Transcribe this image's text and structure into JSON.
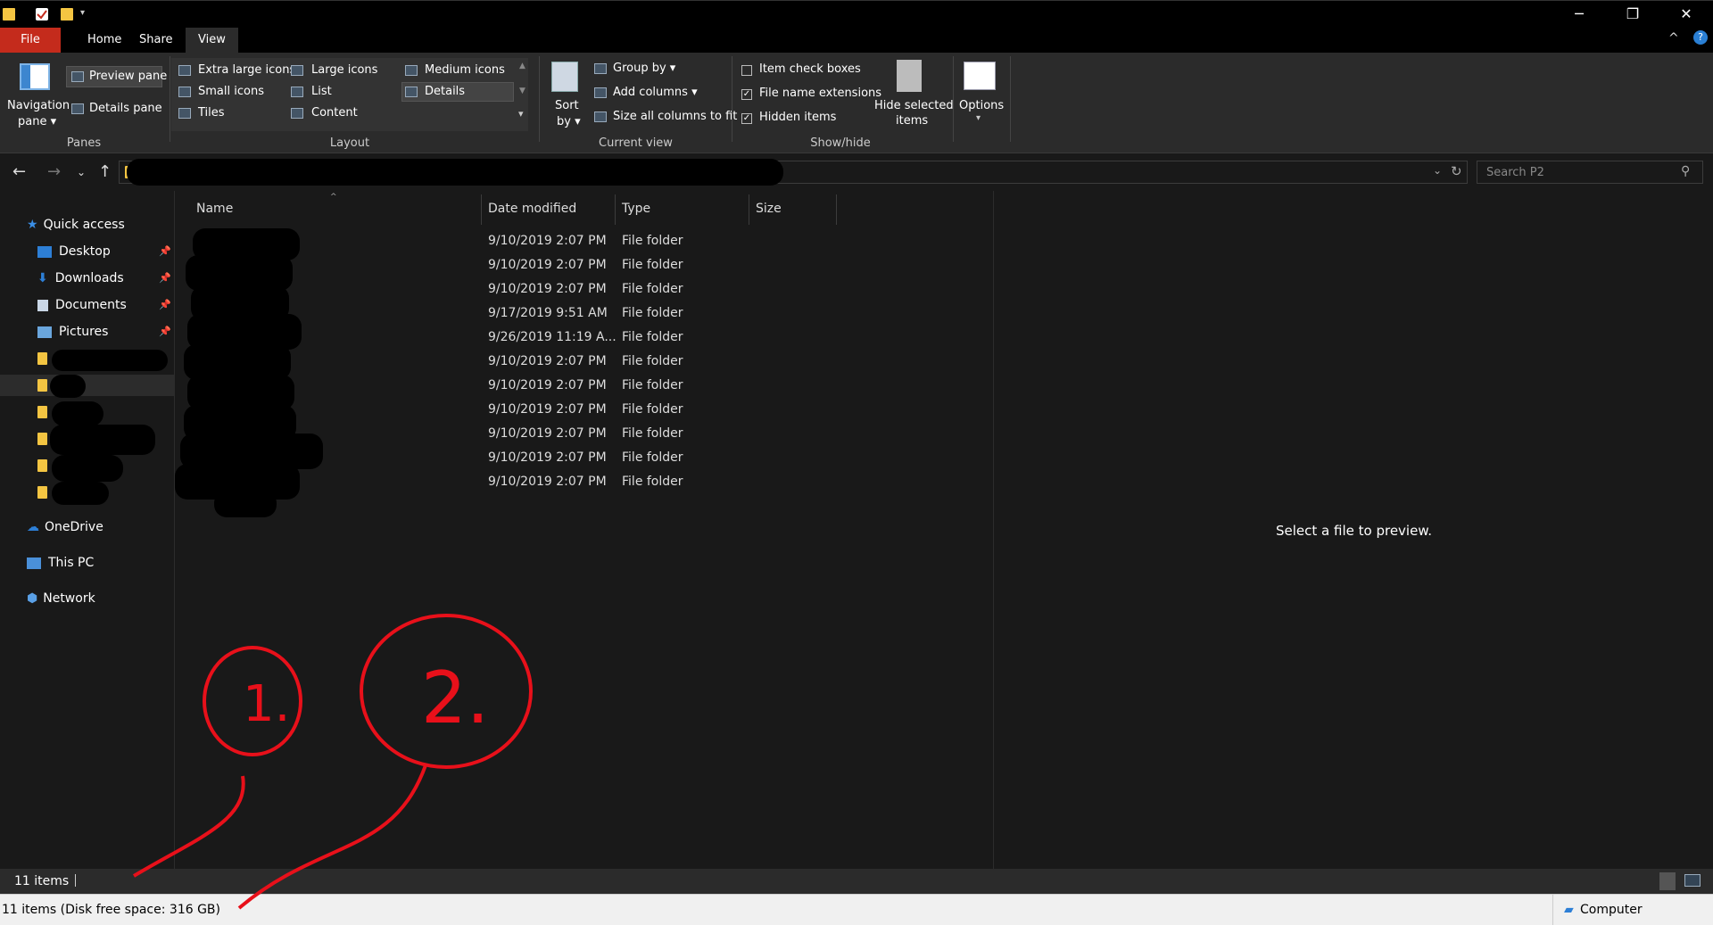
{
  "window": {
    "minimize": "─",
    "restore": "❐",
    "close": "✕"
  },
  "tabs": [
    "File",
    "Home",
    "Share",
    "View"
  ],
  "ribbon": {
    "panes": {
      "navigation_pane_line1": "Navigation",
      "navigation_pane_line2": "pane",
      "preview_pane": "Preview pane",
      "details_pane": "Details pane",
      "group_label": "Panes"
    },
    "layout": {
      "items": [
        "Extra large icons",
        "Large icons",
        "Medium icons",
        "Small icons",
        "List",
        "Details",
        "Tiles",
        "Content"
      ],
      "group_label": "Layout"
    },
    "current_view": {
      "sort_by_line1": "Sort",
      "sort_by_line2": "by",
      "group_by": "Group by",
      "add_columns": "Add columns",
      "size_all_columns": "Size all columns to fit",
      "group_label": "Current view"
    },
    "show_hide": {
      "item_check_boxes": "Item check boxes",
      "file_name_extensions": "File name extensions",
      "hidden_items": "Hidden items",
      "hide_selected_line1": "Hide selected",
      "hide_selected_line2": "items",
      "group_label": "Show/hide",
      "item_check_boxes_checked": false,
      "file_name_extensions_checked": true,
      "hidden_items_checked": true
    },
    "options": {
      "label": "Options"
    }
  },
  "search": {
    "placeholder": "Search P2"
  },
  "nav": {
    "quick_access": "Quick access",
    "desktop": "Desktop",
    "downloads": "Downloads",
    "documents": "Documents",
    "pictures": "Pictures",
    "onedrive": "OneDrive",
    "this_pc": "This PC",
    "network": "Network"
  },
  "columns": {
    "name": "Name",
    "date_modified": "Date modified",
    "type": "Type",
    "size": "Size"
  },
  "rows": [
    {
      "date": "9/10/2019 2:07 PM",
      "type": "File folder"
    },
    {
      "date": "9/10/2019 2:07 PM",
      "type": "File folder"
    },
    {
      "date": "9/10/2019 2:07 PM",
      "type": "File folder"
    },
    {
      "date": "9/17/2019 9:51 AM",
      "type": "File folder"
    },
    {
      "date": "9/26/2019 11:19 A...",
      "type": "File folder"
    },
    {
      "date": "9/10/2019 2:07 PM",
      "type": "File folder"
    },
    {
      "date": "9/10/2019 2:07 PM",
      "type": "File folder"
    },
    {
      "date": "9/10/2019 2:07 PM",
      "type": "File folder"
    },
    {
      "date": "9/10/2019 2:07 PM",
      "type": "File folder"
    },
    {
      "date": "9/10/2019 2:07 PM",
      "type": "File folder"
    },
    {
      "date": "9/10/2019 2:07 PM",
      "type": "File folder"
    }
  ],
  "preview": {
    "message": "Select a file to preview."
  },
  "status": {
    "items": "11 items"
  },
  "classic_status": {
    "text": "11 items (Disk free space: 316 GB)",
    "zone": "Computer"
  },
  "annotations": {
    "one": "1.",
    "two": "2."
  },
  "colors": {
    "file_tab": "#c42b1c",
    "annotation": "#e8101a",
    "folder": "#f4c542"
  }
}
